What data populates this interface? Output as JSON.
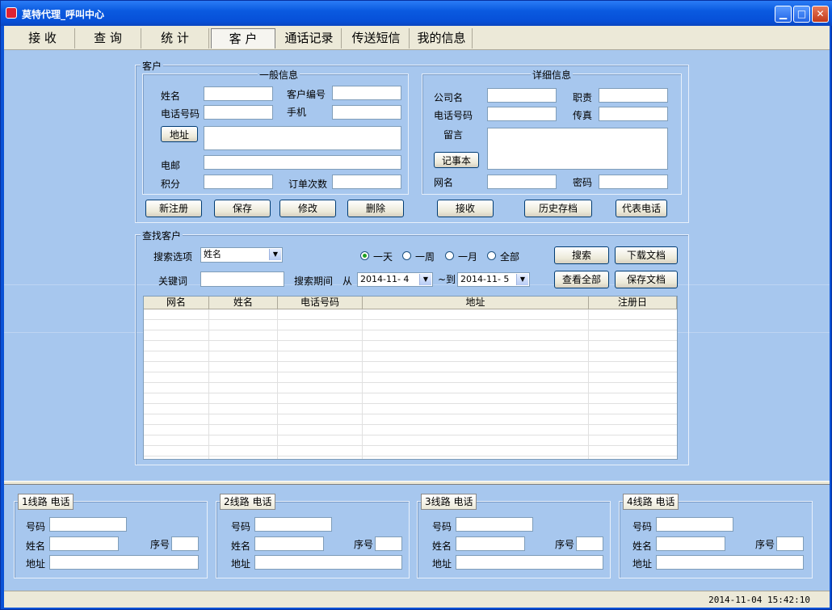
{
  "window": {
    "title": "莫特代理_呼叫中心",
    "min": "▁",
    "max": "□",
    "close": "✕"
  },
  "menu": {
    "tabs": [
      "接 收",
      "查 询",
      "统 计",
      "客 户",
      "通话记录",
      "传送短信",
      "我的信息"
    ]
  },
  "customer": {
    "group_title": "客户",
    "general": {
      "title": "一般信息",
      "name": "姓名",
      "code": "客户编号",
      "phone": "电话号码",
      "mobile": "手机",
      "address_btn": "地址",
      "email": "电邮",
      "points": "积分",
      "orders": "订单次数"
    },
    "detail": {
      "title": "详细信息",
      "company": "公司名",
      "duty": "职责",
      "phone": "电话号码",
      "fax": "传真",
      "memo": "留言",
      "notebook_btn": "记事本",
      "netname": "网名",
      "password": "密码"
    },
    "buttons": [
      "新注册",
      "保存",
      "修改",
      "删除",
      "接收",
      "历史存档",
      "代表电话"
    ]
  },
  "search": {
    "group_title": "查找客户",
    "option_label": "搜索选项",
    "option_value": "姓名",
    "keyword_label": "关键词",
    "period_label": "搜索期间",
    "from": "从",
    "to": "~到",
    "date_from": "2014-11- 4",
    "date_to": "2014-11- 5",
    "radios": [
      "一天",
      "一周",
      "一月",
      "全部"
    ],
    "buttons": [
      "搜索",
      "下载文档",
      "查看全部",
      "保存文档"
    ],
    "columns": [
      "网名",
      "姓名",
      "电话号码",
      "地址",
      "注册日"
    ]
  },
  "lines": [
    {
      "title": "1线路  电话",
      "number": "号码",
      "name": "姓名",
      "seq": "序号",
      "address": "地址"
    },
    {
      "title": "2线路  电话",
      "number": "号码",
      "name": "姓名",
      "seq": "序号",
      "address": "地址"
    },
    {
      "title": "3线路  电话",
      "number": "号码",
      "name": "姓名",
      "seq": "序号",
      "address": "地址"
    },
    {
      "title": "4线路  电话",
      "number": "号码",
      "name": "姓名",
      "seq": "序号",
      "address": "地址"
    }
  ],
  "status": {
    "datetime": "2014-11-04 15:42:10"
  }
}
